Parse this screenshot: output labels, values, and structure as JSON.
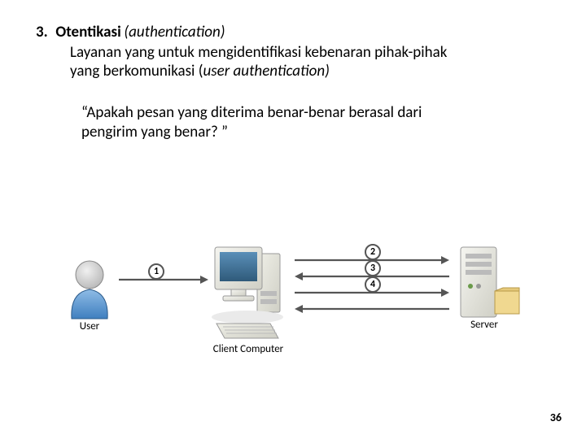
{
  "list_number": "3.",
  "title": {
    "bold": "Otentikasi",
    "italic_paren": "(authentication)"
  },
  "description": {
    "line1": "Layanan yang untuk mengidentifikasi kebenaran pihak-pihak",
    "line2_pre": "yang berkomunikasi (",
    "line2_italic": "user authentication)"
  },
  "quote": {
    "line1": "“Apakah pesan yang diterima benar-benar berasal dari",
    "line2": "pengirim yang benar? ”"
  },
  "diagram": {
    "user_label": "User",
    "client_label": "Client Computer",
    "server_label": "Server",
    "steps": [
      "1",
      "2",
      "3",
      "4"
    ]
  },
  "page_number": "36"
}
